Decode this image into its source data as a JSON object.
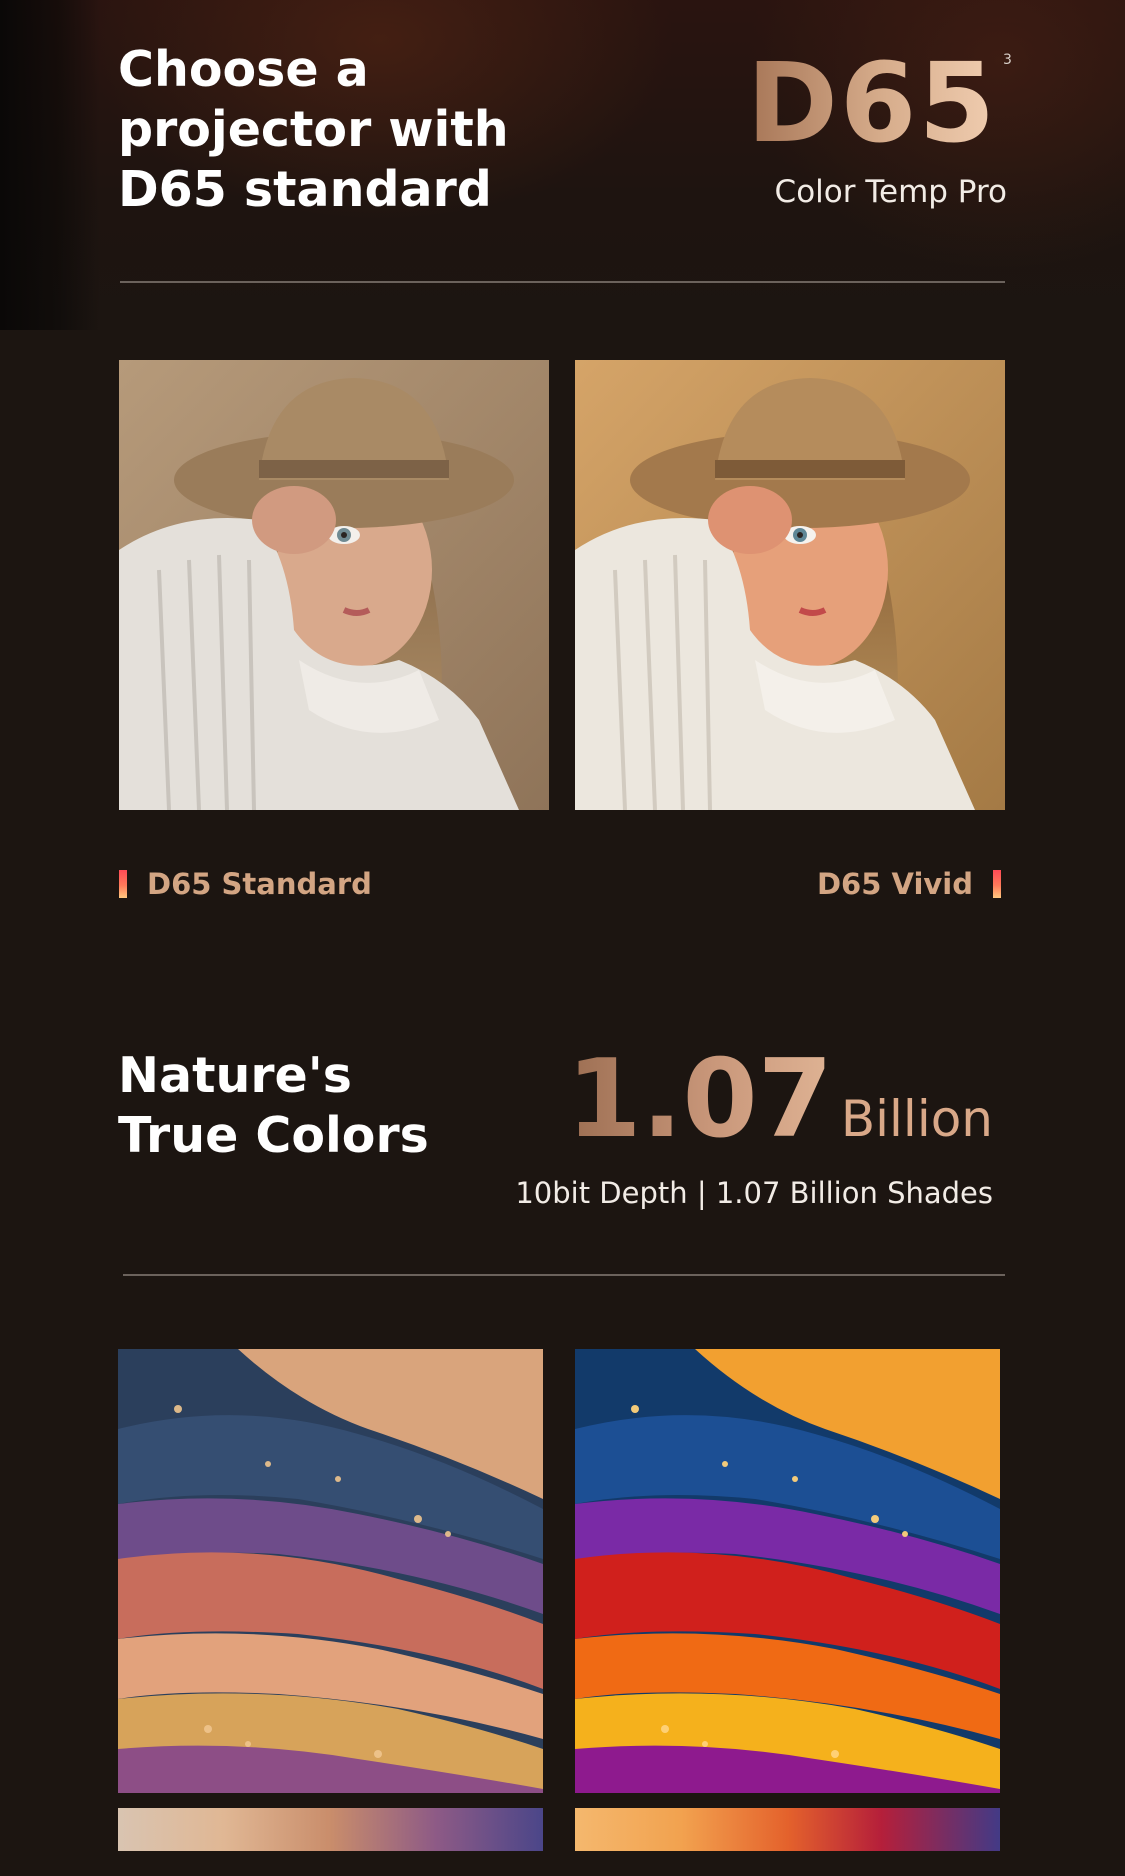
{
  "section1": {
    "headline_lines": [
      "Choose a",
      "projector with",
      "D65 standard"
    ],
    "big_value": "D65",
    "superscript": "3",
    "subtitle": "Color Temp Pro",
    "comparison_labels": {
      "left": "D65 Standard",
      "right": "D65 Vivid"
    }
  },
  "section2": {
    "headline_lines": [
      "Nature's",
      "True Colors"
    ],
    "big_value": "1.07",
    "big_unit": "Billion",
    "subtitle": "10bit Depth | 1.07 Billion Shades"
  },
  "colors": {
    "background": "#1c1511",
    "accent_gradient_start": "#a77657",
    "accent_gradient_end": "#f0cdb0",
    "label_color": "#d3a583",
    "tick_gradient": [
      "#ff4a56",
      "#ffc780"
    ]
  }
}
